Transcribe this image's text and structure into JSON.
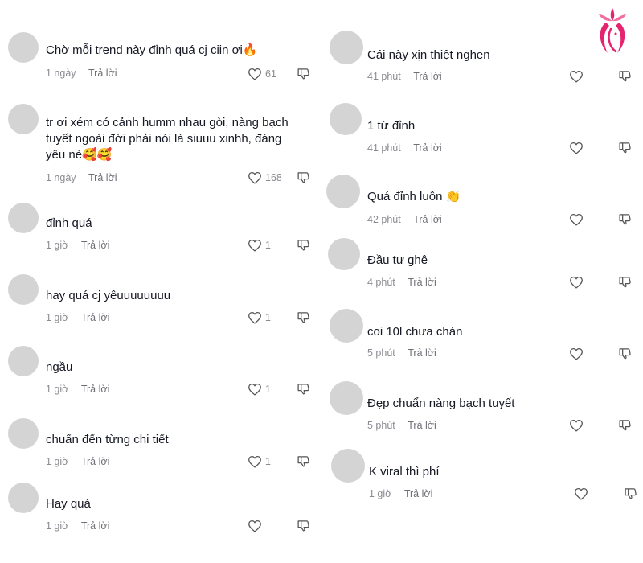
{
  "colors": {
    "avatar": "#d4d4d4",
    "meta": "#8a8b91",
    "text": "#161823",
    "logo": "#e5246f"
  },
  "logo_icon": "pink-lotus-face-logo",
  "left_comments": [
    {
      "text": "Chờ mỗi trend này đỉnh quá cj ciin ơi🔥",
      "time": "1 ngày",
      "reply": "Trả lời",
      "likes": "61"
    },
    {
      "text_lines": [
        "tr ơi xém có cảnh humm nhau gòi, nàng bạch",
        "tuyết ngoài đời phải nói là siuuu xinhh, đáng",
        "yêu nè🥰🥰"
      ],
      "time": "1 ngày",
      "reply": "Trả lời",
      "likes": "168"
    },
    {
      "text": "đỉnh quá",
      "time": "1 giờ",
      "reply": "Trả lời",
      "likes": "1"
    },
    {
      "text": "hay quá cj yêuuuuuuuu",
      "time": "1 giờ",
      "reply": "Trả lời",
      "likes": "1"
    },
    {
      "text": "ngầu",
      "time": "1 giờ",
      "reply": "Trả lời",
      "likes": "1"
    },
    {
      "text": "chuẩn đến từng chi tiết",
      "time": "1 giờ",
      "reply": "Trả lời",
      "likes": "1"
    },
    {
      "text": "Hay quá",
      "time": "1 giờ",
      "reply": "Trả lời",
      "likes": ""
    }
  ],
  "right_comments": [
    {
      "text": "Cái này xịn thiệt nghen",
      "time": "41 phút",
      "reply": "Trả lời"
    },
    {
      "text": "1 từ đỉnh",
      "time": "41 phút",
      "reply": "Trả lời"
    },
    {
      "text": "Quá đỉnh luôn 👏",
      "time": "42 phút",
      "reply": "Trả lời"
    },
    {
      "text": "Đầu tư ghê",
      "time": "4 phút",
      "reply": "Trả lời"
    },
    {
      "text": "coi 10l chưa chán",
      "time": "5 phút",
      "reply": "Trả lời"
    },
    {
      "text": "Đẹp chuẩn nàng bạch tuyết",
      "time": "5 phút",
      "reply": "Trả lời"
    },
    {
      "text": "K viral thì phí",
      "time": "1 giờ",
      "reply": "Trả lời"
    }
  ]
}
